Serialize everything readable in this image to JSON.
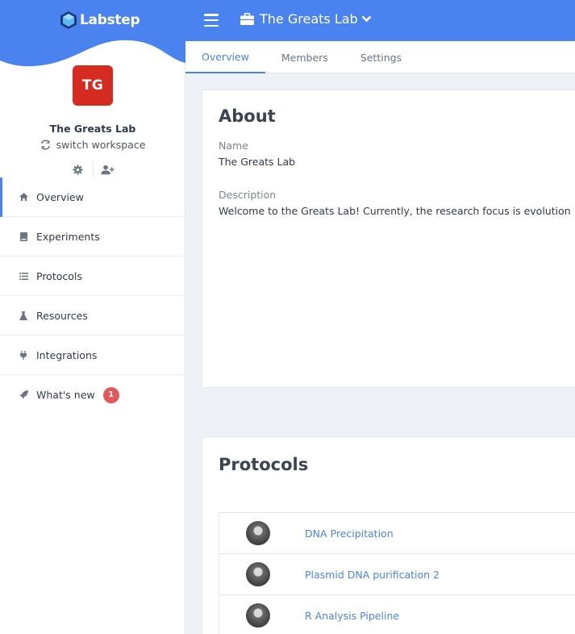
{
  "brand": {
    "logo_text": "Labstep",
    "primary_color": "#4a83f0"
  },
  "workspace": {
    "initials": "TG",
    "avatar_color": "#d62b20",
    "name": "The Greats Lab",
    "switch_label": "switch workspace"
  },
  "sidebar": {
    "items": [
      {
        "label": "Overview",
        "icon": "home-icon",
        "active": true
      },
      {
        "label": "Experiments",
        "icon": "book-icon"
      },
      {
        "label": "Protocols",
        "icon": "list-icon"
      },
      {
        "label": "Resources",
        "icon": "flask-icon"
      },
      {
        "label": "Integrations",
        "icon": "plug-icon"
      },
      {
        "label": "What's new",
        "icon": "rocket-icon",
        "badge": "1"
      }
    ]
  },
  "topbar": {
    "title": "The Greats Lab"
  },
  "tabs": [
    {
      "label": "Overview",
      "active": true
    },
    {
      "label": "Members"
    },
    {
      "label": "Settings"
    }
  ],
  "about": {
    "title": "About",
    "name_label": "Name",
    "name_value": "The Greats Lab",
    "description_label": "Description",
    "description_value": "Welcome to the Greats Lab! Currently, the research focus is evolution"
  },
  "protocols": {
    "title": "Protocols",
    "items": [
      {
        "name": "DNA Precipitation"
      },
      {
        "name": "Plasmid DNA purification 2"
      },
      {
        "name": "R Analysis Pipeline"
      }
    ]
  }
}
